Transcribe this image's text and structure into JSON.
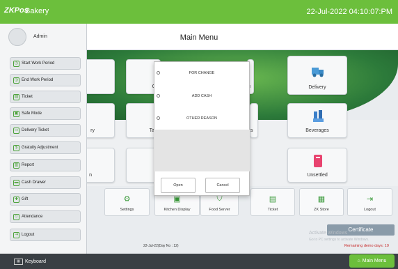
{
  "app": {
    "logo": "ZKPos",
    "business_name": "Bakery",
    "datetime": "22-Jul-2022 04:10:07:PM"
  },
  "header": {
    "title": "Main Menu"
  },
  "user": {
    "name": "Admin"
  },
  "sidebar": {
    "items": [
      {
        "label": "Start Work Period",
        "icon": "clock-icon"
      },
      {
        "label": "End Work Period",
        "icon": "clock-end-icon"
      },
      {
        "label": "Ticket",
        "icon": "ticket-icon"
      },
      {
        "label": "Safe Mode",
        "icon": "shield-icon"
      },
      {
        "label": "Delivery Ticket",
        "icon": "delivery-icon"
      },
      {
        "label": "Gratuity Adjustment",
        "icon": "gratuity-icon"
      },
      {
        "label": "Report",
        "icon": "report-icon"
      },
      {
        "label": "Cash Drawer",
        "icon": "cash-drawer-icon"
      },
      {
        "label": "Gift",
        "icon": "gift-icon"
      },
      {
        "label": "Attendance",
        "icon": "attendance-icon"
      },
      {
        "label": "Logout",
        "icon": "logout-icon"
      }
    ]
  },
  "tiles": {
    "row1": [
      "Qu",
      "u",
      "Delivery"
    ],
    "row2": [
      "ry",
      "Ta",
      "s",
      "Beverages"
    ],
    "row3": [
      "n",
      "Unsettled"
    ]
  },
  "bottom_tiles": [
    {
      "label": "Settings",
      "icon": "gear-icon"
    },
    {
      "label": "Kitchen Display",
      "icon": "kitchen-display-icon"
    },
    {
      "label": "Food Server",
      "icon": "food-server-icon"
    },
    {
      "label": "Ticket",
      "icon": "ticket-icon"
    },
    {
      "label": "ZK Store",
      "icon": "store-icon"
    },
    {
      "label": "Logout",
      "icon": "logout-icon"
    }
  ],
  "dialog": {
    "options": [
      "FOR CHANGE",
      "ADD CASH",
      "OTHER REASON"
    ],
    "open_label": "Open",
    "cancel_label": "Cancel"
  },
  "footer": {
    "day_info": "22-Jul-22(Day No : 12)",
    "certificate_label": "Certificate",
    "watermark_title": "Activate Windows",
    "watermark_sub": "Go to PC settings to activate Windows.",
    "demo_days": "Remaining demo days: 19",
    "keyboard_label": "Keyboard",
    "main_menu_label": "Main Menu"
  },
  "colors": {
    "accent": "#6cbf3c",
    "footer": "#3a3f44",
    "alert": "#c62828"
  }
}
